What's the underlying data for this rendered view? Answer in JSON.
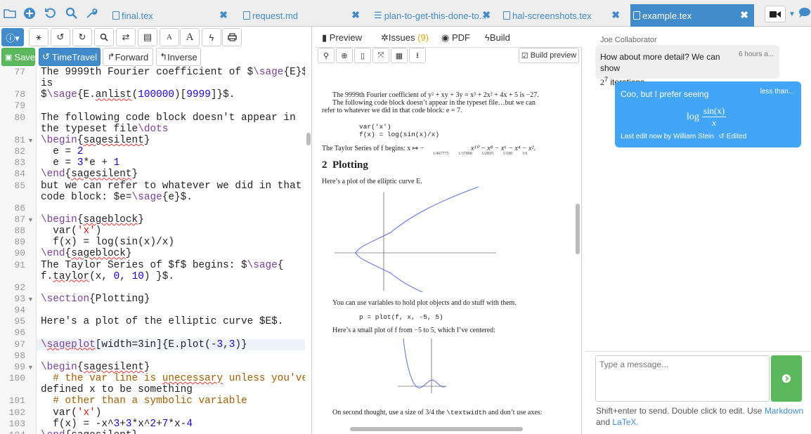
{
  "tabs": [
    {
      "label": "final.tex",
      "active": false
    },
    {
      "label": "request.md",
      "active": false
    },
    {
      "label": "plan-to-get-this-done-to...",
      "active": false
    },
    {
      "label": "hal-screenshots.tex",
      "active": false
    },
    {
      "label": "example.tex",
      "active": true
    }
  ],
  "colors": {
    "accent": "#428bca",
    "chat_blue": "#42a5f5"
  },
  "editor": {
    "toolbar": {
      "font_small": "A",
      "font_large": "A"
    },
    "save_label": "Save",
    "timetravel_label": "TimeTravel",
    "forward_label": "Forward",
    "inverse_label": "Inverse",
    "lines": [
      {
        "n": "77",
        "fold": false,
        "t": "The 9999th Fourier coefficient of $\\sage{E}$"
      },
      {
        "n": "",
        "fold": false,
        "t": "is"
      },
      {
        "n": "78",
        "fold": false,
        "t": "$\\sage{E.anlist(100000)[9999]}$."
      },
      {
        "n": "79",
        "fold": false,
        "t": ""
      },
      {
        "n": "80",
        "fold": false,
        "t": "The following code block doesn't appear in"
      },
      {
        "n": "",
        "fold": false,
        "t": "the typeset file\\dots"
      },
      {
        "n": "81",
        "fold": true,
        "t": "\\begin{sagesilent}"
      },
      {
        "n": "82",
        "fold": false,
        "t": "  e = 2"
      },
      {
        "n": "83",
        "fold": false,
        "t": "  e = 3*e + 1"
      },
      {
        "n": "84",
        "fold": false,
        "t": "\\end{sagesilent}"
      },
      {
        "n": "85",
        "fold": false,
        "t": "but we can refer to whatever we did in that"
      },
      {
        "n": "",
        "fold": false,
        "t": "code block: $e=\\sage{e}$."
      },
      {
        "n": "86",
        "fold": false,
        "t": ""
      },
      {
        "n": "87",
        "fold": true,
        "t": "\\begin{sageblock}"
      },
      {
        "n": "88",
        "fold": false,
        "t": "  var('x')"
      },
      {
        "n": "89",
        "fold": false,
        "t": "  f(x) = log(sin(x)/x)"
      },
      {
        "n": "90",
        "fold": false,
        "t": "\\end{sageblock}"
      },
      {
        "n": "91",
        "fold": false,
        "t": "The Taylor Series of $f$ begins: $\\sage{"
      },
      {
        "n": "",
        "fold": false,
        "t": "f.taylor(x, 0, 10) }$."
      },
      {
        "n": "92",
        "fold": false,
        "t": ""
      },
      {
        "n": "93",
        "fold": true,
        "t": "\\section{Plotting}"
      },
      {
        "n": "94",
        "fold": false,
        "t": ""
      },
      {
        "n": "95",
        "fold": false,
        "t": "Here's a plot of the elliptic curve $E$."
      },
      {
        "n": "96",
        "fold": false,
        "t": ""
      },
      {
        "n": "97",
        "fold": false,
        "t": "\\sageplot[width=3in]{E.plot(-3,3)}"
      },
      {
        "n": "98",
        "fold": false,
        "t": ""
      },
      {
        "n": "99",
        "fold": true,
        "t": "\\begin{sagesilent}"
      },
      {
        "n": "100",
        "fold": false,
        "t": "  # the var line is unecessary unless you've"
      },
      {
        "n": "",
        "fold": false,
        "t": "defined x to be something"
      },
      {
        "n": "101",
        "fold": false,
        "t": "  # other than a symbolic variable"
      },
      {
        "n": "102",
        "fold": false,
        "t": "  var('x')"
      },
      {
        "n": "103",
        "fold": false,
        "t": "  f(x) = -x^3+3*x^2+7*x-4"
      },
      {
        "n": "104",
        "fold": false,
        "t": "\\end{sagesilent}"
      }
    ]
  },
  "preview": {
    "tabs": {
      "preview": "Preview",
      "issues": "Issues",
      "issues_count": "(9)",
      "pdf": "PDF",
      "build": "Build"
    },
    "build_preview_label": "Build preview",
    "doc": {
      "p1a": "The 9999th Fourier coefficient of y² + xy + 3y = x³ + 2x² + 4x + 5 is −27.",
      "p1b": "The following code block doesn’t appear in the typeset file…but we can",
      "p1c": "refer to whatever we did in that code block: e = 7.",
      "code1": "var('x')",
      "code2": "f(x) = log(sin(x)/x)",
      "taylor": "The Taylor Series of f begins: x ↦ −",
      "taylor_terms": "x¹⁰ − x⁸ − x⁶ − x⁴ − x².",
      "taylor_coeffs": [
        "1/467775",
        "1/37800",
        "1/2835",
        "1/180",
        "1/6"
      ],
      "sec_num": "2",
      "sec_title": "Plotting",
      "p2": "Here’s a plot of the elliptic curve E.",
      "p3": "You can use variables to hold plot objects and do stuff with them.",
      "code3": "p = plot(f, x, -5, 5)",
      "p4": "Here’s a small plot of f from −5 to 5, which I’ve centered:",
      "p5a": "On second thought, use a size of 3/4 the",
      "p5b": "\\textwidth",
      "p5c": "and don’t use axes:"
    }
  },
  "chat": {
    "collaborator": "Joe Collaborator",
    "msg1": "How about more detail? We can show",
    "msg1_math": "2",
    "msg1_sup": "7",
    "msg1_rest": " iterations.",
    "msg1_time": "6 hours a...",
    "msg2": "Coo, but I prefer seeing",
    "msg2_time": "less than...",
    "msg2_log": "log",
    "msg2_num": "sin(x)",
    "msg2_den": "x",
    "msg2_footer": "Last edit now by William Stein",
    "msg2_edited": "Edited",
    "placeholder": "Type a message...",
    "help_a": "Shift+enter to send. Double click to edit. Use",
    "help_md": "Markdown",
    "help_b": "and",
    "help_latex": "LaTeX."
  }
}
